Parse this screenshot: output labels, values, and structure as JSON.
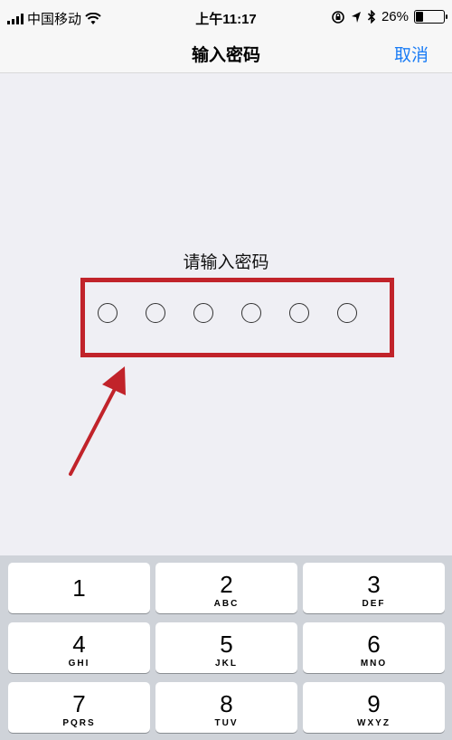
{
  "status_bar": {
    "carrier": "中国移动",
    "time": "上午11:17",
    "battery_percent": "26%",
    "battery_level": 0.26,
    "icons": [
      "signal-icon",
      "wifi-icon",
      "lock-rotation-icon",
      "location-icon",
      "bluetooth-icon",
      "battery-icon"
    ]
  },
  "nav": {
    "title": "输入密码",
    "cancel_label": "取消"
  },
  "passcode": {
    "prompt": "请输入密码",
    "dot_count": 6
  },
  "keyboard": {
    "keys": [
      {
        "num": "1",
        "letters": ""
      },
      {
        "num": "2",
        "letters": "ABC"
      },
      {
        "num": "3",
        "letters": "DEF"
      },
      {
        "num": "4",
        "letters": "GHI"
      },
      {
        "num": "5",
        "letters": "JKL"
      },
      {
        "num": "6",
        "letters": "MNO"
      },
      {
        "num": "7",
        "letters": "PQRS"
      },
      {
        "num": "8",
        "letters": "TUV"
      },
      {
        "num": "9",
        "letters": "WXYZ"
      }
    ]
  },
  "colors": {
    "accent": "#1a7cf5",
    "annotation_red": "#c1232a"
  }
}
